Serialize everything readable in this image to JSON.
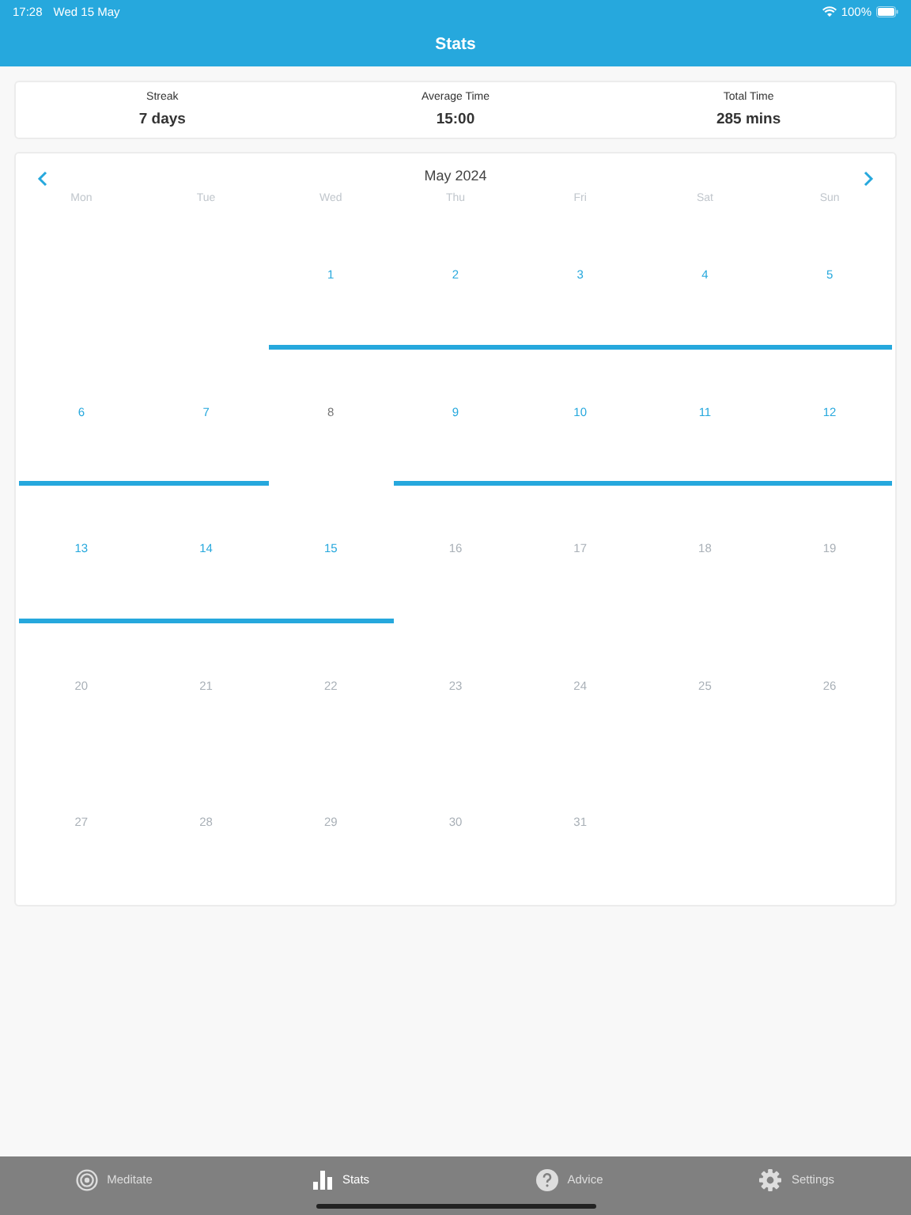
{
  "status_bar": {
    "time": "17:28",
    "date": "Wed 15 May",
    "battery": "100%"
  },
  "header": {
    "title": "Stats"
  },
  "summary": [
    {
      "label": "Streak",
      "value": "7 days"
    },
    {
      "label": "Average Time",
      "value": "15:00"
    },
    {
      "label": "Total Time",
      "value": "285 mins"
    }
  ],
  "calendar": {
    "month": "May 2024",
    "weekdays": [
      "Mon",
      "Tue",
      "Wed",
      "Thu",
      "Fri",
      "Sat",
      "Sun"
    ],
    "weeks": [
      {
        "days": [
          {
            "label": "1",
            "kind": "meditated"
          },
          {
            "label": "2",
            "kind": "meditated"
          },
          {
            "label": "3",
            "kind": "meditated"
          },
          {
            "label": "4",
            "kind": "meditated"
          },
          {
            "label": "5",
            "kind": "meditated"
          }
        ]
      },
      {
        "days": [
          {
            "label": "6",
            "kind": "meditated"
          },
          {
            "label": "7",
            "kind": "meditated"
          },
          {
            "label": "8",
            "kind": "past"
          },
          {
            "label": "9",
            "kind": "meditated"
          },
          {
            "label": "10",
            "kind": "meditated"
          },
          {
            "label": "11",
            "kind": "meditated"
          },
          {
            "label": "12",
            "kind": "meditated"
          }
        ]
      },
      {
        "days": [
          {
            "label": "13",
            "kind": "meditated"
          },
          {
            "label": "14",
            "kind": "meditated"
          },
          {
            "label": "15",
            "kind": "meditated"
          },
          {
            "label": "16",
            "kind": "future"
          },
          {
            "label": "17",
            "kind": "future"
          },
          {
            "label": "18",
            "kind": "future"
          },
          {
            "label": "19",
            "kind": "future"
          }
        ]
      },
      {
        "days": [
          {
            "label": "20",
            "kind": "future"
          },
          {
            "label": "21",
            "kind": "future"
          },
          {
            "label": "22",
            "kind": "future"
          },
          {
            "label": "23",
            "kind": "future"
          },
          {
            "label": "24",
            "kind": "future"
          },
          {
            "label": "25",
            "kind": "future"
          },
          {
            "label": "26",
            "kind": "future"
          }
        ]
      },
      {
        "days": [
          {
            "label": "27",
            "kind": "future"
          },
          {
            "label": "28",
            "kind": "future"
          },
          {
            "label": "29",
            "kind": "future"
          },
          {
            "label": "30",
            "kind": "future"
          },
          {
            "label": "31",
            "kind": "future"
          }
        ]
      }
    ]
  },
  "tabs": [
    {
      "label": "Meditate",
      "selected": false
    },
    {
      "label": "Stats",
      "selected": true
    },
    {
      "label": "Advice",
      "selected": false
    },
    {
      "label": "Settings",
      "selected": false
    }
  ]
}
